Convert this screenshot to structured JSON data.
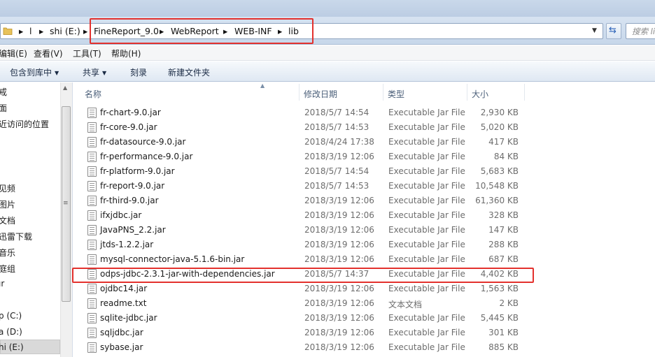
{
  "address_bar": {
    "breadcrumb": [
      "l",
      "shi (E:)",
      "FineReport_9.0",
      "WebReport",
      "WEB-INF",
      "lib"
    ],
    "search_placeholder": "搜索 li"
  },
  "menu": [
    "编辑(E)",
    "查看(V)",
    "工具(T)",
    "帮助(H)"
  ],
  "commands": {
    "include_library": "包含到库中",
    "share": "共享",
    "burn": "刻录",
    "new_folder": "新建文件夹"
  },
  "nav_items": [
    "戒",
    "面",
    "近访问的位置",
    "见频",
    "图片",
    "文档",
    "迅雷下载",
    "音乐",
    "庭组",
    "ır",
    "p (C:)",
    "a (D:)",
    "hi (E:)"
  ],
  "columns": {
    "name": "名称",
    "date": "修改日期",
    "type": "类型",
    "size": "大小"
  },
  "files": [
    {
      "name": "fr-chart-9.0.jar",
      "date": "2018/5/7 14:54",
      "type": "Executable Jar File",
      "size": "2,930 KB"
    },
    {
      "name": "fr-core-9.0.jar",
      "date": "2018/5/7 14:53",
      "type": "Executable Jar File",
      "size": "5,020 KB"
    },
    {
      "name": "fr-datasource-9.0.jar",
      "date": "2018/4/24 17:38",
      "type": "Executable Jar File",
      "size": "417 KB"
    },
    {
      "name": "fr-performance-9.0.jar",
      "date": "2018/3/19 12:06",
      "type": "Executable Jar File",
      "size": "84 KB"
    },
    {
      "name": "fr-platform-9.0.jar",
      "date": "2018/5/7 14:54",
      "type": "Executable Jar File",
      "size": "5,683 KB"
    },
    {
      "name": "fr-report-9.0.jar",
      "date": "2018/5/7 14:53",
      "type": "Executable Jar File",
      "size": "10,548 KB"
    },
    {
      "name": "fr-third-9.0.jar",
      "date": "2018/3/19 12:06",
      "type": "Executable Jar File",
      "size": "61,360 KB"
    },
    {
      "name": "ifxjdbc.jar",
      "date": "2018/3/19 12:06",
      "type": "Executable Jar File",
      "size": "328 KB"
    },
    {
      "name": "JavaPNS_2.2.jar",
      "date": "2018/3/19 12:06",
      "type": "Executable Jar File",
      "size": "147 KB"
    },
    {
      "name": "jtds-1.2.2.jar",
      "date": "2018/3/19 12:06",
      "type": "Executable Jar File",
      "size": "288 KB"
    },
    {
      "name": "mysql-connector-java-5.1.6-bin.jar",
      "date": "2018/3/19 12:06",
      "type": "Executable Jar File",
      "size": "687 KB"
    },
    {
      "name": "odps-jdbc-2.3.1-jar-with-dependencies.jar",
      "date": "2018/5/7 14:37",
      "type": "Executable Jar File",
      "size": "4,402 KB"
    },
    {
      "name": "ojdbc14.jar",
      "date": "2018/3/19 12:06",
      "type": "Executable Jar File",
      "size": "1,563 KB"
    },
    {
      "name": "readme.txt",
      "date": "2018/3/19 12:06",
      "type": "文本文档",
      "size": "2 KB"
    },
    {
      "name": "sqlite-jdbc.jar",
      "date": "2018/3/19 12:06",
      "type": "Executable Jar File",
      "size": "5,445 KB"
    },
    {
      "name": "sqljdbc.jar",
      "date": "2018/3/19 12:06",
      "type": "Executable Jar File",
      "size": "301 KB"
    },
    {
      "name": "sybase.jar",
      "date": "2018/3/19 12:06",
      "type": "Executable Jar File",
      "size": "885 KB"
    }
  ],
  "colors": {
    "highlight_box": "#e3312d",
    "selected_nav_bg": "#d9d9d9",
    "window_chrome": "#c7d7ea"
  }
}
